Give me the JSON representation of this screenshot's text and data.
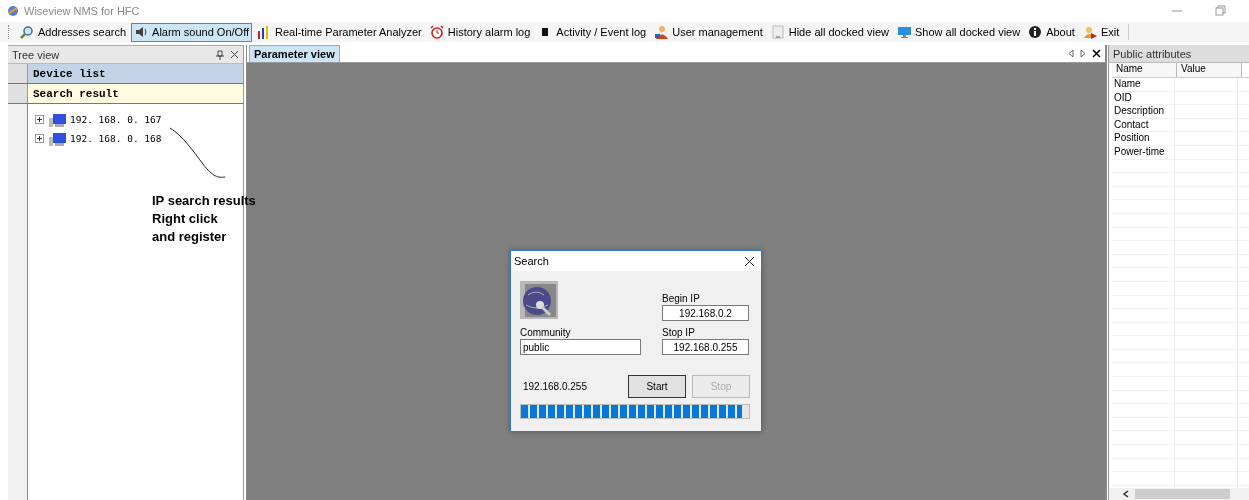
{
  "window": {
    "title": "Wiseview NMS for HFC"
  },
  "toolbar": [
    {
      "label": "Addresses search",
      "kind": "search",
      "selected": false
    },
    {
      "label": "Alarm sound On/Off",
      "kind": "speaker",
      "selected": true
    },
    {
      "label": "Real-time Parameter Analyzer",
      "kind": "bars",
      "selected": false
    },
    {
      "label": "History alarm log",
      "kind": "clock",
      "selected": false
    },
    {
      "label": "Activity / Event log",
      "kind": "log",
      "selected": false
    },
    {
      "label": "User management",
      "kind": "user",
      "selected": false
    },
    {
      "label": "Hide all docked view",
      "kind": "hide",
      "selected": false
    },
    {
      "label": "Show all docked view",
      "kind": "monitor",
      "selected": false
    },
    {
      "label": "About",
      "kind": "info",
      "selected": false
    },
    {
      "label": "Exit",
      "kind": "exit",
      "selected": false
    }
  ],
  "tree_view": {
    "title": "Tree view",
    "sections": [
      {
        "label": "Device list",
        "selected": false
      },
      {
        "label": "Search result",
        "selected": true
      }
    ],
    "items": [
      {
        "label": "192. 168. 0. 167",
        "expanded": false
      },
      {
        "label": "192. 168. 0. 168",
        "expanded": false
      }
    ],
    "annotation": [
      "IP search results",
      "Right click",
      "and register"
    ]
  },
  "parameter_view": {
    "tabs": [
      {
        "label": "Parameter view",
        "selected": true
      }
    ]
  },
  "search_dialog": {
    "title": "Search",
    "begin_ip_label": "Begin IP",
    "begin_ip": "192.168.0.2",
    "community_label": "Community",
    "community": "public",
    "stop_ip_label": "Stop IP",
    "stop_ip": "192.168.0.255",
    "status": "192.168.0.255",
    "buttons": [
      {
        "label": "Start",
        "disabled": false
      },
      {
        "label": "Stop",
        "disabled": true
      }
    ],
    "progress": {
      "level": 0.97
    }
  },
  "public_attributes": {
    "title": "Public attributes",
    "columns": [
      "Name",
      "Value"
    ],
    "rows": [
      {
        "name": "Name"
      },
      {
        "name": "OID"
      },
      {
        "name": "Description"
      },
      {
        "name": "Contact"
      },
      {
        "name": "Position"
      },
      {
        "name": "Power-time"
      }
    ]
  }
}
